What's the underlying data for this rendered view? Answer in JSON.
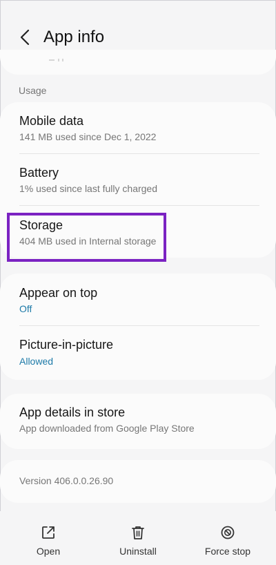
{
  "header": {
    "title": "App info"
  },
  "section": {
    "usage_label": "Usage"
  },
  "usage_items": [
    {
      "title": "Mobile data",
      "subtitle": "141 MB used since Dec 1, 2022"
    },
    {
      "title": "Battery",
      "subtitle": "1% used since last fully charged"
    },
    {
      "title": "Storage",
      "subtitle": "404 MB used in Internal storage"
    }
  ],
  "permission_items": [
    {
      "title": "Appear on top",
      "subtitle": "Off"
    },
    {
      "title": "Picture-in-picture",
      "subtitle": "Allowed"
    }
  ],
  "store_item": {
    "title": "App details in store",
    "subtitle": "App downloaded from Google Play Store"
  },
  "version": {
    "text": "Version 406.0.0.26.90"
  },
  "actions": {
    "open": "Open",
    "uninstall": "Uninstall",
    "force_stop": "Force stop"
  },
  "colors": {
    "accent": "#1d7aa8",
    "highlight": "#7b22c2"
  }
}
